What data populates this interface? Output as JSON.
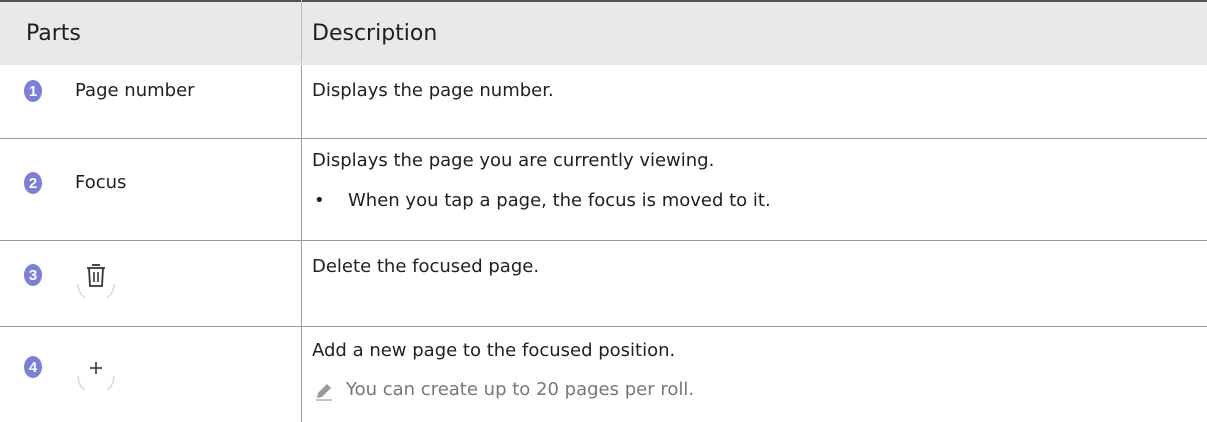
{
  "header": {
    "parts": "Parts",
    "description": "Description"
  },
  "rows": [
    {
      "number": "1",
      "part": "Page number",
      "description": "Displays the page number."
    },
    {
      "number": "2",
      "part": "Focus",
      "description": "Displays the page you are currently viewing.",
      "bullet": "When you tap a page, the focus is moved to it."
    },
    {
      "number": "3",
      "icon": "trash-icon",
      "description": "Delete the focused page."
    },
    {
      "number": "4",
      "icon": "plus-icon",
      "description": "Add a new page to the focused position.",
      "note": "You can create up to 20 pages per roll."
    }
  ],
  "colors": {
    "badge": "#7b7fd6",
    "header_bg": "#e9e9e9",
    "note_text": "#777777"
  },
  "glyphs": {
    "bullet": "•",
    "plus": "+"
  }
}
